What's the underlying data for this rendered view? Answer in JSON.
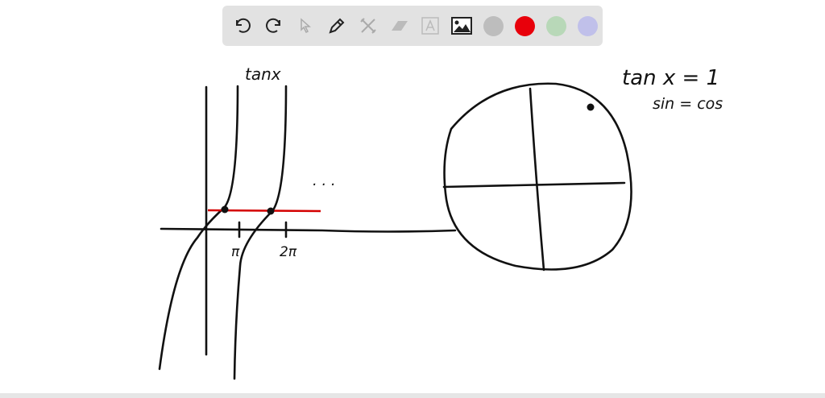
{
  "toolbar": {
    "tools": [
      "undo",
      "redo",
      "select",
      "pen",
      "tools",
      "eraser",
      "text",
      "image"
    ],
    "colors": [
      "#bdbdbd",
      "#e8000b",
      "#b8d8b8",
      "#c0c0ea"
    ]
  },
  "drawing": {
    "graph_label": "tanx",
    "tick_pi": "π",
    "tick_2pi": "2π",
    "ellipsis": ". . .",
    "equation": "tan x = 1",
    "equation2": "sin = cos",
    "line_color": "#d40000"
  }
}
